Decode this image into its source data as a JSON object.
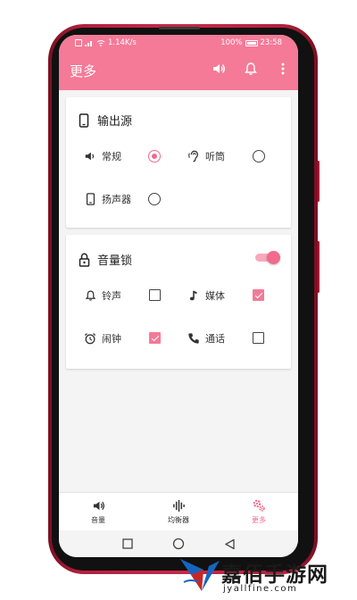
{
  "status_bar": {
    "network_speed": "1.14K/s",
    "battery": "100%",
    "time": "23:58"
  },
  "app_bar": {
    "title": "更多",
    "icons": [
      "volume-icon",
      "bell-icon",
      "more-vert-icon"
    ]
  },
  "output_card": {
    "title": "输出源",
    "options": [
      {
        "label": "常规",
        "icon": "speaker-icon",
        "selected": true
      },
      {
        "label": "听筒",
        "icon": "earpiece-icon",
        "selected": false
      },
      {
        "label": "扬声器",
        "icon": "phone-icon",
        "selected": false
      }
    ]
  },
  "lock_card": {
    "title": "音量锁",
    "enabled": true,
    "items": [
      {
        "label": "铃声",
        "icon": "bell-icon",
        "checked": false
      },
      {
        "label": "媒体",
        "icon": "music-note-icon",
        "checked": true
      },
      {
        "label": "闹钟",
        "icon": "alarm-icon",
        "checked": true
      },
      {
        "label": "通话",
        "icon": "call-icon",
        "checked": false
      }
    ]
  },
  "bottom_nav": [
    {
      "label": "音量",
      "icon": "volume-icon",
      "active": false
    },
    {
      "label": "均衡器",
      "icon": "equalizer-icon",
      "active": false
    },
    {
      "label": "更多",
      "icon": "gears-icon",
      "active": true
    }
  ],
  "watermark": {
    "title": "嘉佰手游网",
    "url": "jyallfine.com"
  },
  "colors": {
    "accent": "#f47a97",
    "accent_dark": "#f26a8d",
    "frame": "#c72a48"
  }
}
